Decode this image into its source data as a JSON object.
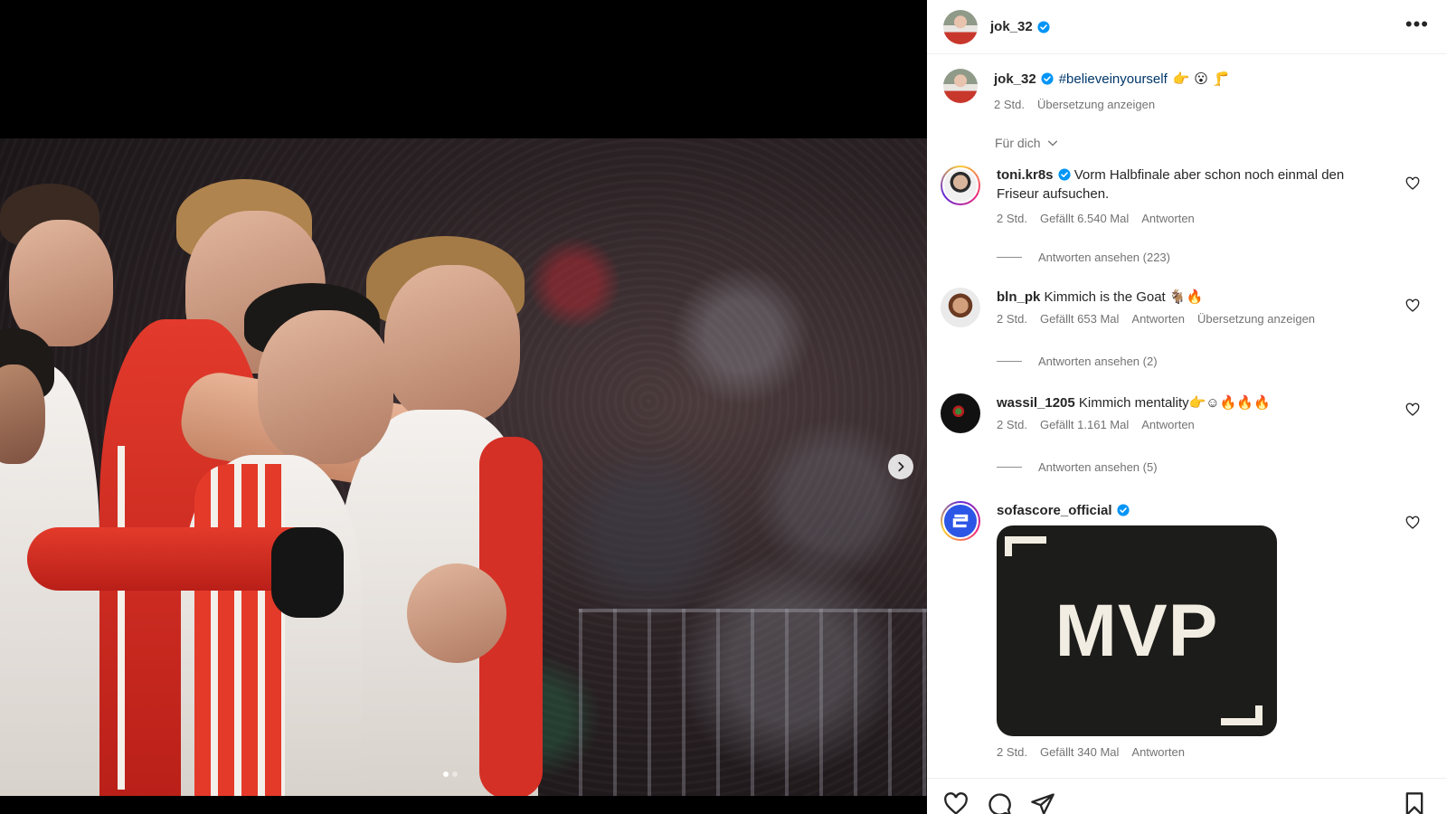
{
  "post": {
    "author": "jok_32",
    "verified": true,
    "caption_hashtag": "#believeinyourself",
    "caption_emojis": "👉 😮 🦵",
    "time": "2 Std.",
    "translate": "Übersetzung anzeigen"
  },
  "filter": {
    "label": "Für dich",
    "icon": "chevron-down-icon"
  },
  "comments": [
    {
      "username": "toni.kr8s",
      "verified": true,
      "text": "Vorm Halbfinale aber schon noch einmal den Friseur aufsuchen.",
      "time": "2 Std.",
      "likes": "Gefällt 6.540 Mal",
      "reply": "Antworten",
      "view_replies": "Antworten ansehen (223)"
    },
    {
      "username": "bln_pk",
      "verified": false,
      "text": "Kimmich is the Goat 🐐🔥",
      "time": "2 Std.",
      "likes": "Gefällt 653 Mal",
      "reply": "Antworten",
      "translate": "Übersetzung anzeigen",
      "view_replies": "Antworten ansehen (2)"
    },
    {
      "username": "wassil_1205",
      "verified": false,
      "text": "Kimmich mentality👉☺🔥🔥🔥",
      "time": "2 Std.",
      "likes": "Gefällt 1.161 Mal",
      "reply": "Antworten",
      "view_replies": "Antworten ansehen (5)"
    },
    {
      "username": "sofascore_official",
      "verified": true,
      "image_text": "MVP",
      "time": "2 Std.",
      "likes": "Gefällt 340 Mal",
      "reply": "Antworten"
    }
  ],
  "icons": {
    "more": "more-options-icon",
    "next": "chevron-right-icon",
    "like": "heart-icon",
    "comment": "comment-icon",
    "share": "share-icon",
    "save": "bookmark-icon",
    "verified": "verified-badge-icon"
  },
  "colors": {
    "verified": "#0095f6",
    "hashtag": "#00376b",
    "muted": "#737373"
  },
  "carousel": {
    "slides": 2,
    "active": 1
  }
}
